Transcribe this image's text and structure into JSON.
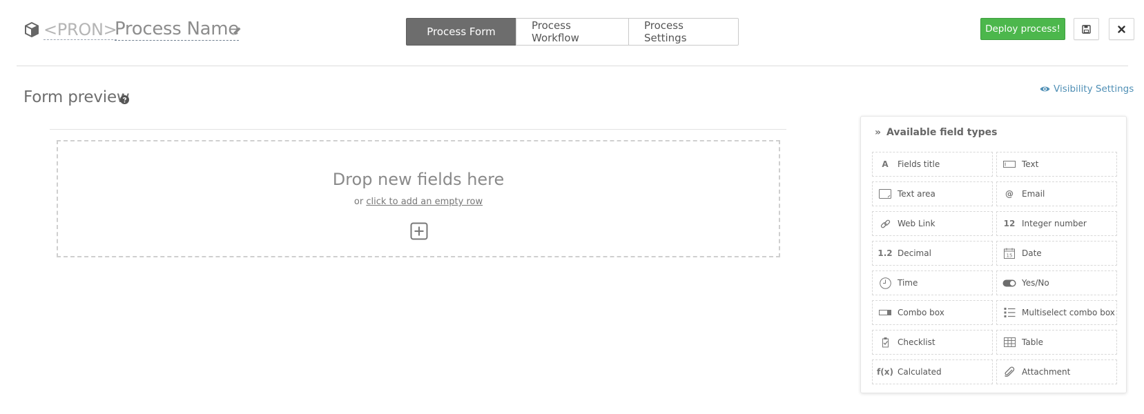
{
  "header": {
    "pron": "<PRON>",
    "process_name": "Process Name",
    "tabs": [
      {
        "label": "Process Form",
        "active": true
      },
      {
        "label": "Process Workflow",
        "active": false
      },
      {
        "label": "Process Settings",
        "active": false
      }
    ],
    "deploy_label": "Deploy process!"
  },
  "form_preview": {
    "title": "Form preview",
    "visibility_label": "Visibility Settings",
    "dropzone": {
      "title": "Drop new fields here",
      "prefix": "or",
      "link": "click to add an empty row"
    }
  },
  "field_types": {
    "title": "Available field types",
    "items": [
      {
        "label": "Fields title",
        "icon": "letter-a-icon",
        "glyph": "A"
      },
      {
        "label": "Text",
        "icon": "text-input-icon",
        "glyph": ""
      },
      {
        "label": "Text area",
        "icon": "textarea-icon",
        "glyph": ""
      },
      {
        "label": "Email",
        "icon": "at-sign-icon",
        "glyph": "@"
      },
      {
        "label": "Web Link",
        "icon": "link-icon",
        "glyph": ""
      },
      {
        "label": "Integer number",
        "icon": "integer-icon",
        "glyph": "12"
      },
      {
        "label": "Decimal",
        "icon": "decimal-icon",
        "glyph": "1.2"
      },
      {
        "label": "Date",
        "icon": "calendar-icon",
        "glyph": "15"
      },
      {
        "label": "Time",
        "icon": "clock-icon",
        "glyph": ""
      },
      {
        "label": "Yes/No",
        "icon": "toggle-icon",
        "glyph": ""
      },
      {
        "label": "Combo box",
        "icon": "combo-box-icon",
        "glyph": ""
      },
      {
        "label": "Multiselect combo box",
        "icon": "list-icon",
        "glyph": ""
      },
      {
        "label": "Checklist",
        "icon": "checklist-icon",
        "glyph": ""
      },
      {
        "label": "Table",
        "icon": "table-icon",
        "glyph": ""
      },
      {
        "label": "Calculated",
        "icon": "function-icon",
        "glyph": "f(x)"
      },
      {
        "label": "Attachment",
        "icon": "paperclip-icon",
        "glyph": ""
      }
    ]
  },
  "colors": {
    "deploy_green": "#4cb74c",
    "active_tab": "#6d6d6d",
    "link_blue": "#4f8fb5"
  }
}
